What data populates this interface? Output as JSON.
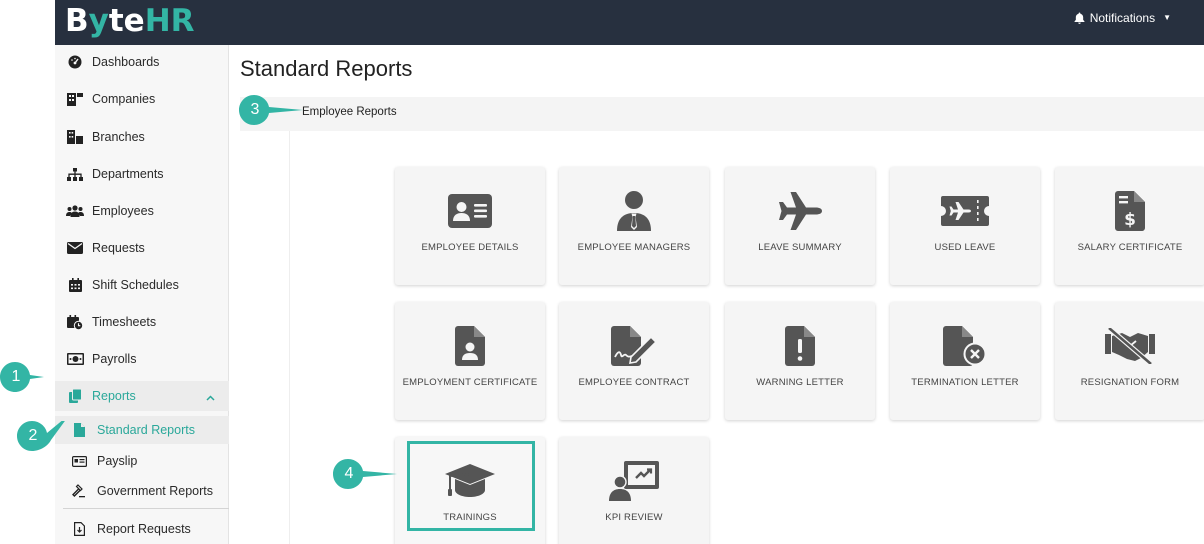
{
  "app": {
    "logo_a": "B",
    "logo_b": "y",
    "logo_c": "te",
    "logo_d": "HR"
  },
  "topbar": {
    "notifications_label": "Notifications"
  },
  "sidebar": {
    "items": [
      {
        "label": "Dashboards",
        "icon": "dashboard-icon"
      },
      {
        "label": "Companies",
        "icon": "building-icon"
      },
      {
        "label": "Branches",
        "icon": "branches-icon"
      },
      {
        "label": "Departments",
        "icon": "sitemap-icon"
      },
      {
        "label": "Employees",
        "icon": "users-icon"
      },
      {
        "label": "Requests",
        "icon": "envelope-icon"
      },
      {
        "label": "Shift Schedules",
        "icon": "calendar-icon"
      },
      {
        "label": "Timesheets",
        "icon": "calendar-clock-icon"
      },
      {
        "label": "Payrolls",
        "icon": "money-icon"
      },
      {
        "label": "Reports",
        "icon": "copy-icon"
      }
    ],
    "sub_items": [
      {
        "label": "Standard Reports",
        "icon": "file-icon"
      },
      {
        "label": "Payslip",
        "icon": "id-card-icon"
      },
      {
        "label": "Government Reports",
        "icon": "gavel-icon"
      },
      {
        "label": "Report Requests",
        "icon": "file-download-icon"
      }
    ]
  },
  "main": {
    "title": "Standard Reports",
    "section": "Employee Reports",
    "cards": [
      {
        "label": "Employee Details",
        "icon": "address-card-icon"
      },
      {
        "label": "Employee Managers",
        "icon": "user-tie-icon"
      },
      {
        "label": "Leave Summary",
        "icon": "plane-icon"
      },
      {
        "label": "Used Leave",
        "icon": "ticket-plane-icon"
      },
      {
        "label": "Salary Certificate",
        "icon": "file-invoice-dollar-icon"
      },
      {
        "label": "Employment Certificate",
        "icon": "file-user-icon"
      },
      {
        "label": "Employee Contract",
        "icon": "file-signature-icon"
      },
      {
        "label": "Warning Letter",
        "icon": "file-exclamation-icon"
      },
      {
        "label": "Termination Letter",
        "icon": "file-times-icon"
      },
      {
        "label": "Resignation Form",
        "icon": "no-handshake-icon"
      },
      {
        "label": "Trainings",
        "icon": "graduation-cap-icon"
      },
      {
        "label": "KPI Review",
        "icon": "chalkboard-teacher-icon"
      }
    ]
  },
  "callouts": [
    "1",
    "2",
    "3",
    "4"
  ],
  "colors": {
    "accent": "#33b5a5",
    "topbar": "#27303f",
    "icon": "#555555"
  }
}
